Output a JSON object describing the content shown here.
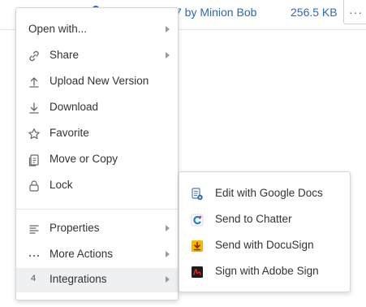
{
  "file_row": {
    "modified_by": "7 by Minion Bob",
    "size": "256.5 KB",
    "more_glyph": "···"
  },
  "menu": {
    "items": [
      {
        "label": "Open with...",
        "icon": "none",
        "submenu": true
      },
      {
        "label": "Share",
        "icon": "link-icon",
        "submenu": true
      },
      {
        "label": "Upload New Version",
        "icon": "upload-icon",
        "submenu": false
      },
      {
        "label": "Download",
        "icon": "download-icon",
        "submenu": false
      },
      {
        "label": "Favorite",
        "icon": "star-icon",
        "submenu": false
      },
      {
        "label": "Move or Copy",
        "icon": "copy-icon",
        "submenu": false
      },
      {
        "label": "Lock",
        "icon": "lock-icon",
        "submenu": false
      },
      {
        "label": "Properties",
        "icon": "list-icon",
        "submenu": true
      },
      {
        "label": "More Actions",
        "icon": "ellipsis-icon",
        "submenu": true
      },
      {
        "label": "Integrations",
        "icon": "integrations-icon",
        "submenu": true,
        "badge": "4",
        "active": true
      }
    ]
  },
  "submenu": {
    "items": [
      {
        "label": "Edit with Google Docs",
        "icon": "google-docs-icon"
      },
      {
        "label": "Send to Chatter",
        "icon": "chatter-icon"
      },
      {
        "label": "Send with DocuSign",
        "icon": "docusign-icon"
      },
      {
        "label": "Sign with Adobe Sign",
        "icon": "adobe-sign-icon"
      }
    ]
  },
  "colors": {
    "accent": "#2a6ab7",
    "hover_bg": "#eef0f2",
    "text": "#333333",
    "docusign": "#f5b800",
    "adobe": "#c4000a",
    "chatter": "#1f7ed8"
  }
}
